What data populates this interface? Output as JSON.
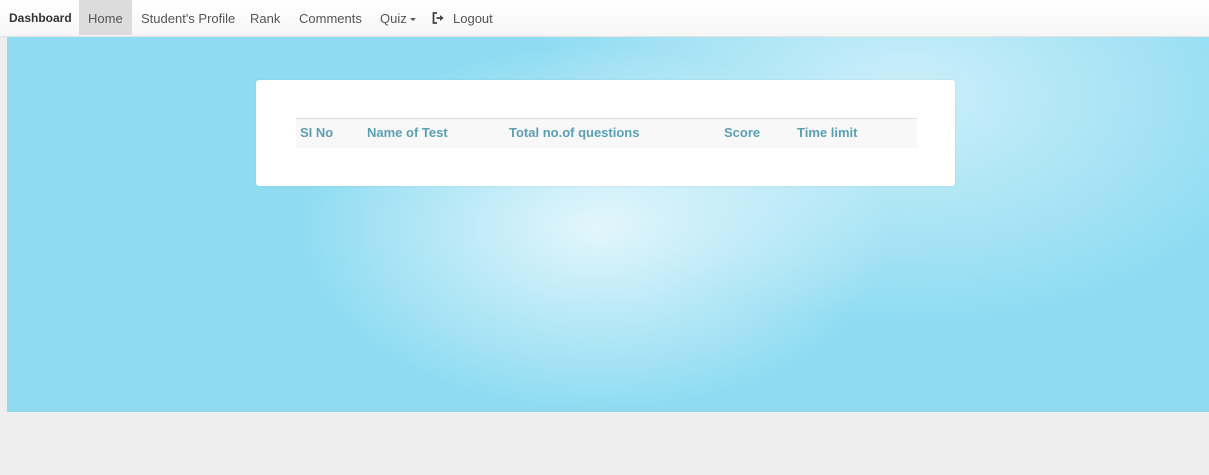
{
  "navbar": {
    "brand": "Dashboard",
    "items": [
      {
        "label": "Home",
        "active": true
      },
      {
        "label": "Student's Profile"
      },
      {
        "label": "Rank"
      },
      {
        "label": "Comments"
      },
      {
        "label": "Quiz"
      }
    ],
    "logout": {
      "label": "Logout",
      "icon": "sign-out-icon"
    }
  },
  "table": {
    "columns": [
      "SI No",
      "Name of Test",
      "Total no.of questions",
      "Score",
      "Time limit"
    ],
    "rows": []
  },
  "colors": {
    "hero_bg": "#8fdcf2",
    "header_text": "#5b9fb3",
    "footer_bg": "#eeeeee"
  }
}
